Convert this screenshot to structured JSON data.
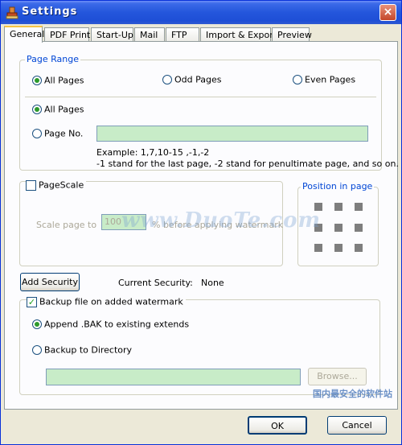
{
  "window": {
    "title": "Settings",
    "close": "×"
  },
  "tabs": [
    {
      "label": "General"
    },
    {
      "label": "PDF Print"
    },
    {
      "label": "Start-Up"
    },
    {
      "label": "Mail"
    },
    {
      "label": "FTP"
    },
    {
      "label": "Import & Export"
    },
    {
      "label": "Preview"
    }
  ],
  "page_range": {
    "legend": "Page Range",
    "all_pages_1": "All Pages",
    "odd_pages": "Odd Pages",
    "even_pages": "Even Pages",
    "all_pages_2": "All Pages",
    "page_no": "Page No.",
    "page_no_value": "",
    "example_line1": "Example: 1,7,10-15 ,-1,-2",
    "example_line2": "-1 stand for the last page, -2 stand for penultimate page, and so on."
  },
  "page_scale": {
    "label": "PageScale",
    "checked": false,
    "scale_label": "Scale page to",
    "scale_value": "100",
    "suffix": "% before applying watermark"
  },
  "position": {
    "legend": "Position in page"
  },
  "security": {
    "button": "Add Security",
    "current_label": "Current Security:",
    "current_value": "None"
  },
  "backup": {
    "label": "Backup file on added watermark",
    "checked": true,
    "append_label": "Append .BAK to existing extends",
    "directory_label": "Backup to Directory",
    "directory_value": "",
    "browse": "Browse..."
  },
  "footer": {
    "ok": "OK",
    "cancel": "Cancel"
  },
  "watermarks": {
    "center": "www.DuoTe.com",
    "corner": "国内最安全的软件站"
  }
}
